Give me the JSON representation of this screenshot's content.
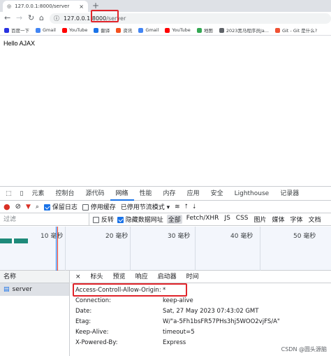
{
  "browser": {
    "tab_title": "127.0.0.1:8000/server",
    "tab_close": "×",
    "new_tab": "+",
    "url_host": "127.0.0.1:8000",
    "url_path": "/server",
    "bookmarks": [
      {
        "label": "百度一下",
        "color": "#2932e1"
      },
      {
        "label": "Gmail",
        "color": "#4285f4"
      },
      {
        "label": "YouTube",
        "color": "#ff0000"
      },
      {
        "label": "翻译",
        "color": "#1a73e8"
      },
      {
        "label": "资讯",
        "color": "#f4511e"
      },
      {
        "label": "Gmail",
        "color": "#4285f4"
      },
      {
        "label": "YouTube",
        "color": "#ff0000"
      },
      {
        "label": "地图",
        "color": "#34a853"
      },
      {
        "label": "2023黑马程序员Ja...",
        "color": "#5f6368"
      },
      {
        "label": "Git - Git 是什么?",
        "color": "#f05133"
      }
    ]
  },
  "page": {
    "body_text": "Hello AJAX"
  },
  "devtools": {
    "tabs": [
      "元素",
      "控制台",
      "源代码",
      "网络",
      "性能",
      "内存",
      "应用",
      "安全",
      "Lighthouse",
      "记录器"
    ],
    "active_tab": "网络",
    "preserve_log": "保留日志",
    "disable_cache": "停用缓存",
    "throttle": "已停用节流模式",
    "filter_placeholder": "过滤",
    "invert": "反转",
    "hide_data_urls": "隐藏数据网址",
    "filter_types": [
      "全部",
      "Fetch/XHR",
      "JS",
      "CSS",
      "图片",
      "媒体",
      "字体",
      "文档"
    ],
    "timeline_labels": [
      "10 毫秒",
      "20 毫秒",
      "30 毫秒",
      "40 毫秒",
      "50 毫秒"
    ],
    "name_header": "名称",
    "request_name": "server",
    "detail_close": "×",
    "detail_tabs": [
      "标头",
      "预览",
      "响应",
      "启动器",
      "时间"
    ],
    "headers": [
      {
        "k": "Access-Controll-Allow-Origin:",
        "v": "*"
      },
      {
        "k": "Connection:",
        "v": "keep-alive"
      },
      {
        "k": "Date:",
        "v": "Sat, 27 May 2023 07:43:02 GMT"
      },
      {
        "k": "Etag:",
        "v": "W/\"a-5Fh1bsFR57PHs3hj5WOO2vjFS/A\""
      },
      {
        "k": "Keep-Alive:",
        "v": "timeout=5"
      },
      {
        "k": "X-Powered-By:",
        "v": "Express"
      }
    ]
  },
  "watermark": "CSDN @圆头源脑",
  "colors": {
    "highlight": "#e0242a",
    "accent": "#1a73e8"
  }
}
